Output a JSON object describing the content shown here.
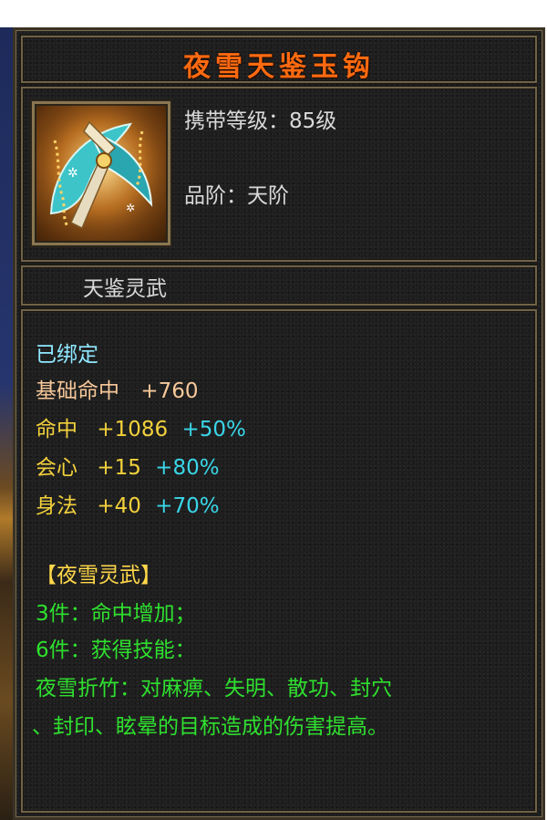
{
  "item": {
    "name": "夜雪天鉴玉钩",
    "carry_level": "携带等级：85级",
    "grade": "品阶：天阶",
    "set_title": "天鉴灵武",
    "icon": "jade-hook-weapon-icon"
  },
  "attributes": {
    "bound": "已绑定",
    "base_hit": {
      "label": "基础命中",
      "value": "+760"
    },
    "hit": {
      "label": "命中",
      "value": "+1086",
      "bonus": "+50%"
    },
    "crit": {
      "label": "会心",
      "value": "+15",
      "bonus": "+80%"
    },
    "agility": {
      "label": "身法",
      "value": "+40",
      "bonus": "+70%"
    }
  },
  "set_bonus": {
    "name": "【夜雪灵武】",
    "piece3": "3件：命中增加；",
    "piece6": "6件：获得技能：",
    "skill_line1": "夜雪折竹：对麻痹、失明、散功、封穴",
    "skill_line2": "、封印、眩晕的目标造成的伤害提高。"
  },
  "colors": {
    "title": "#ff6a10",
    "bound": "#8fe8ff",
    "base_stat": "#f7c89a",
    "stat": "#f3d13b",
    "bonus": "#3ad6e8",
    "set": "#2fe02f"
  }
}
